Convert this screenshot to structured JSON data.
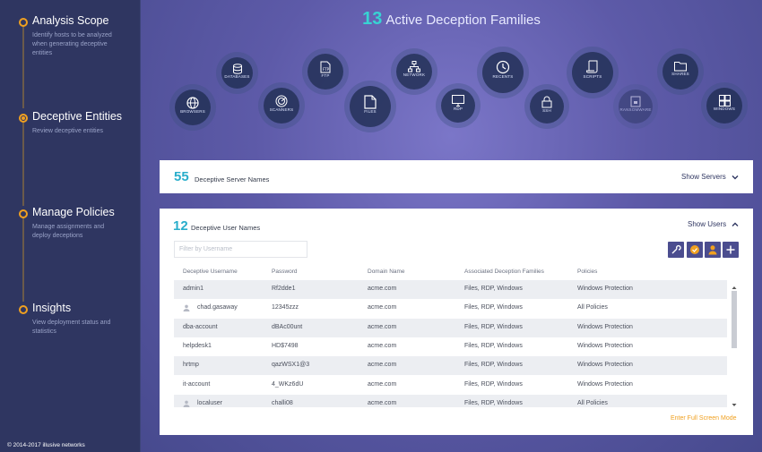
{
  "sidebar": {
    "steps": [
      {
        "title": "Analysis Scope",
        "desc": "Identify hosts to be analyzed when generating deceptive entities"
      },
      {
        "title": "Deceptive Entities",
        "desc": "Review deceptive entities"
      },
      {
        "title": "Manage Policies",
        "desc": "Manage assignments and deploy deceptions"
      },
      {
        "title": "Insights",
        "desc": "View deployment status and statistics"
      }
    ],
    "active_step": 1,
    "copyright": "© 2014-2017 illusive networks"
  },
  "families": {
    "count": "13",
    "title": "Active Deception Families",
    "items": [
      {
        "label": "BROWSERS",
        "icon": "globe-icon"
      },
      {
        "label": "DATABASES",
        "icon": "database-icon"
      },
      {
        "label": "SCANNERS",
        "icon": "radar-icon"
      },
      {
        "label": "FTP",
        "icon": "ftp-file-icon"
      },
      {
        "label": "FILES",
        "icon": "file-icon"
      },
      {
        "label": "NETWORK",
        "icon": "network-icon"
      },
      {
        "label": "RDP",
        "icon": "monitor-icon"
      },
      {
        "label": "RECENTS",
        "icon": "clock-icon"
      },
      {
        "label": "SSH",
        "icon": "lock-icon"
      },
      {
        "label": "SCRIPTS",
        "icon": "scroll-icon"
      },
      {
        "label": "RANSOMWARE",
        "icon": "ransomware-icon"
      },
      {
        "label": "SHARES",
        "icon": "folder-icon"
      },
      {
        "label": "WINDOWS",
        "icon": "windows-icon"
      }
    ]
  },
  "servers": {
    "count": "55",
    "label": "Deceptive Server Names",
    "toggle": "Show Servers"
  },
  "users": {
    "count": "12",
    "label": "Deceptive User Names",
    "toggle": "Show Users",
    "filter_placeholder": "Filter by Username",
    "tools": [
      "wrench-icon",
      "badge-check-icon",
      "user-icon",
      "plus-icon"
    ],
    "columns": [
      "Deceptive Username",
      "Password",
      "Domain Name",
      "Associated Deception Families",
      "Policies"
    ],
    "rows": [
      {
        "username": "admin1",
        "password": "Rf2dde1",
        "domain": "acme.com",
        "families": "Files, RDP, Windows",
        "policy": "Windows Protection",
        "user_icon": false
      },
      {
        "username": "chad.gasaway",
        "password": "12345zzz",
        "domain": "acme.com",
        "families": "Files, RDP, Windows",
        "policy": "All Policies",
        "user_icon": true
      },
      {
        "username": "dba-account",
        "password": "dBAc00unt",
        "domain": "acme.com",
        "families": "Files, RDP, Windows",
        "policy": "Windows Protection",
        "user_icon": false
      },
      {
        "username": "helpdesk1",
        "password": "HD$7498",
        "domain": "acme.com",
        "families": "Files, RDP, Windows",
        "policy": "Windows Protection",
        "user_icon": false
      },
      {
        "username": "hrtmp",
        "password": "qazWSX1@3",
        "domain": "acme.com",
        "families": "Files, RDP, Windows",
        "policy": "Windows Protection",
        "user_icon": false
      },
      {
        "username": "it-account",
        "password": "4_WKz6dU",
        "domain": "acme.com",
        "families": "Files, RDP, Windows",
        "policy": "Windows Protection",
        "user_icon": false
      },
      {
        "username": "localuser",
        "password": "challi08",
        "domain": "acme.com",
        "families": "Files, RDP, Windows",
        "policy": "All Policies",
        "user_icon": true
      }
    ],
    "fullscreen_label": "Enter Full Screen Mode"
  },
  "colors": {
    "accent": "#f0a020",
    "count": "#2aaecb",
    "sidebar": "#2f3661"
  }
}
